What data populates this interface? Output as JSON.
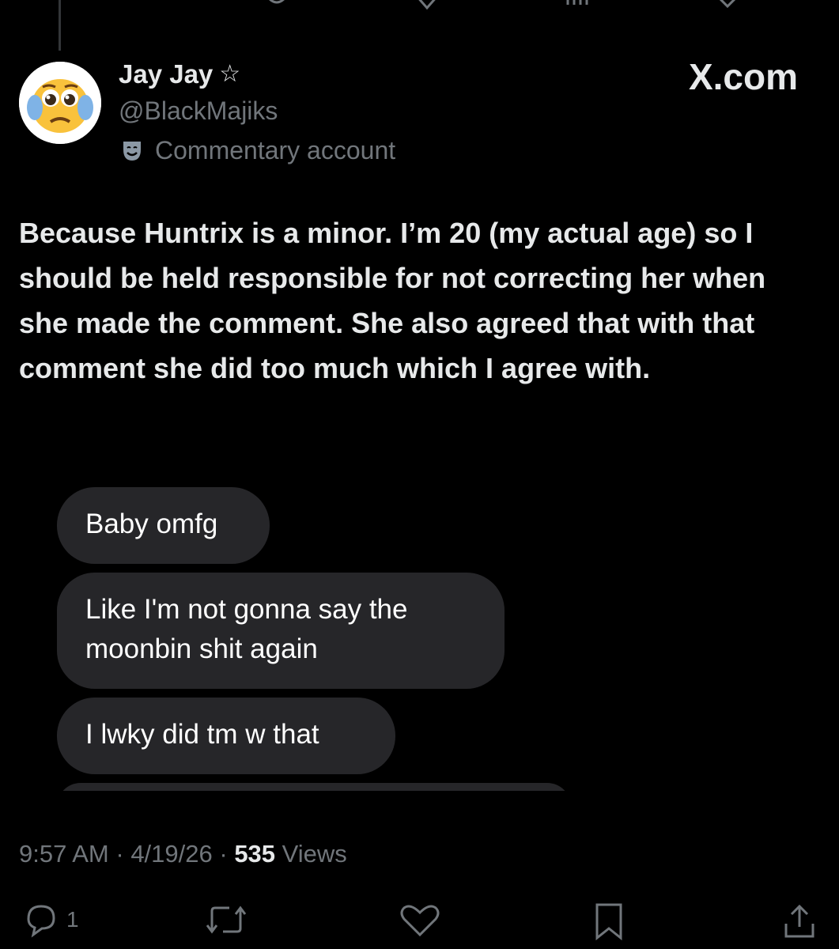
{
  "author": {
    "display_name": "Jay Jay",
    "handle": "@BlackMajiks",
    "account_label": "Commentary account",
    "verified_icon": "star-outline-icon"
  },
  "brand": {
    "text": "X.com",
    "icon": "x-logo-icon"
  },
  "tweet": {
    "text": "Because Huntrix is a minor. I’m 20 (my actual age) so I should be held responsible for not correcting her when she made the comment. She also agreed that with that comment she did too much which I agree with."
  },
  "attachment_messages": [
    "Baby omfg",
    "Like I'm not gonna say the moonbin shit again",
    "I lwky did tm w that"
  ],
  "meta": {
    "time": "9:57 AM",
    "date": "4/19/26",
    "views_count": "535",
    "views_label": "Views"
  },
  "actions": {
    "reply_count": "1"
  },
  "colors": {
    "background": "#000000",
    "primary_text": "#e7e9ea",
    "secondary_text": "#71767b",
    "bubble": "#262629"
  }
}
